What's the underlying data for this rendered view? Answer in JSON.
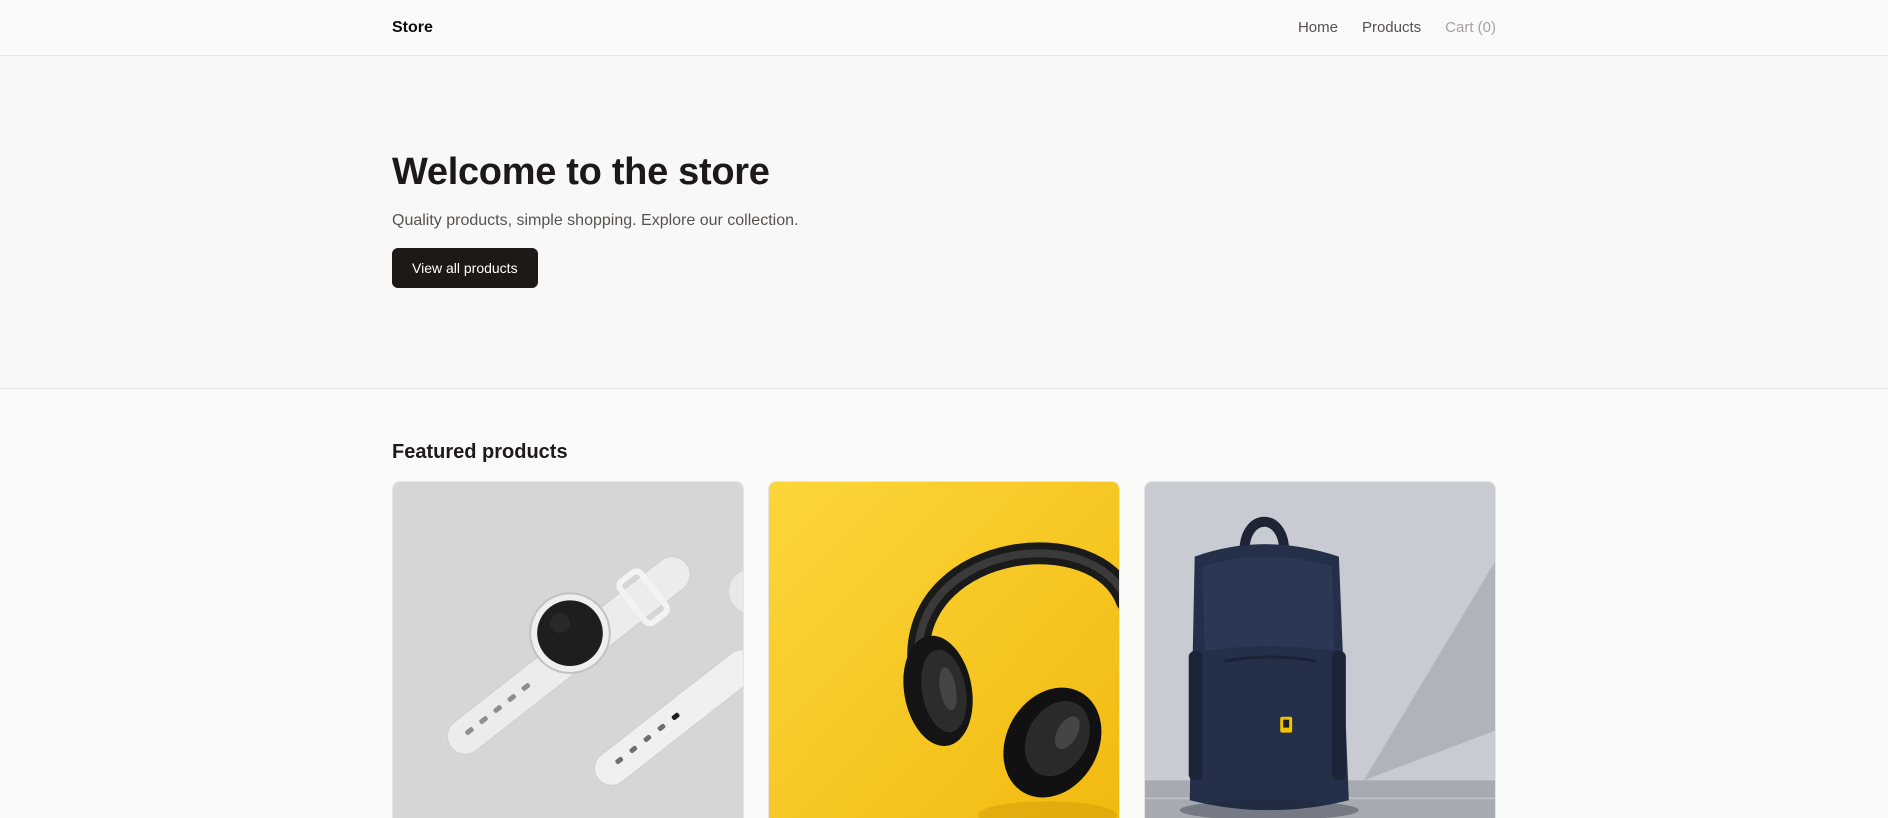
{
  "header": {
    "brand": "Store",
    "nav": {
      "home": "Home",
      "products": "Products",
      "cart": "Cart (0)"
    }
  },
  "hero": {
    "title": "Welcome to the store",
    "subtitle": "Quality products, simple shopping. Explore our collection.",
    "cta_label": "View all products"
  },
  "featured": {
    "title": "Featured products",
    "products": [
      {
        "image": "watch-image",
        "image_bg": "#d6d6d6"
      },
      {
        "image": "headphones-image",
        "image_bg": "#f7c51d"
      },
      {
        "image": "backpack-image",
        "image_bg": "#c9ccd3"
      }
    ]
  },
  "colors": {
    "primary": "#1c1917",
    "background": "#fafaf9",
    "muted_text": "#57534e",
    "border": "#e7e5e4"
  }
}
